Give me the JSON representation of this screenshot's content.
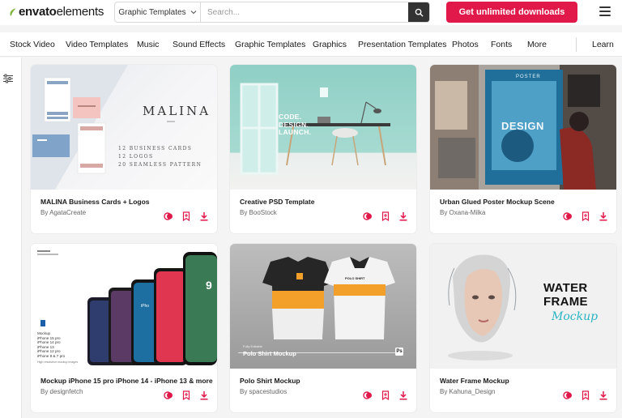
{
  "brand": {
    "logo_bold": "envato",
    "logo_light": "elements",
    "accent": "#e0194a",
    "leaf_color": "#82b440"
  },
  "search": {
    "category": "Graphic Templates",
    "placeholder": "Search..."
  },
  "header": {
    "cta_label": "Get unlimited downloads"
  },
  "nav": {
    "items": [
      "Stock Video",
      "Video Templates",
      "Music",
      "Sound Effects",
      "Graphic Templates",
      "Graphics",
      "Presentation Templates",
      "Photos",
      "Fonts",
      "More"
    ],
    "learn": "Learn"
  },
  "icons": [
    "envato-leaf-icon",
    "chevron-down-icon",
    "search-icon",
    "menu-icon",
    "filter-icon",
    "collection-icon",
    "bookmark-icon",
    "download-icon"
  ],
  "cards": [
    {
      "title": "MALINA Business Cards + Logos",
      "author": "By AgataCreate",
      "thumb": {
        "heading": "MALINA",
        "lines": [
          "12 BUSINESS CARDS",
          "12 LOGOS",
          "20 SEAMLESS PATTERN"
        ]
      }
    },
    {
      "title": "Creative PSD Template",
      "author": "By BooStock",
      "thumb": {
        "lines": [
          "CODE.",
          "DESIGN.",
          "LAUNCH."
        ]
      }
    },
    {
      "title": "Urban Glued Poster Mockup Scene",
      "author": "By Oxana-Milka",
      "thumb": {
        "heading": "DESIGN",
        "sub": "POSTER"
      }
    },
    {
      "title": "Mockup iPhone 15 pro iPhone 14 - iPhone 13 & more",
      "author": "By designfetch",
      "thumb": {
        "lines": [
          "Mockup",
          "iPhone 15 pro",
          "iPhone 14 pro",
          "iPhone 13",
          "iPhone 12 pro",
          "iPhone 8 & 7 pro"
        ],
        "note": "High resolution mockup images"
      }
    },
    {
      "title": "Polo Shirt Mockup",
      "author": "By spacestudios",
      "thumb": {
        "small": "Fully Editable",
        "heading": "Polo Shirt Mockup",
        "badge": "Ps",
        "shirt_text": "POLO SHIRT"
      }
    },
    {
      "title": "Water Frame Mockup",
      "author": "By Kahuna_Design",
      "thumb": {
        "line1": "WATER",
        "line2": "FRAME",
        "script": "Mockup"
      }
    }
  ]
}
